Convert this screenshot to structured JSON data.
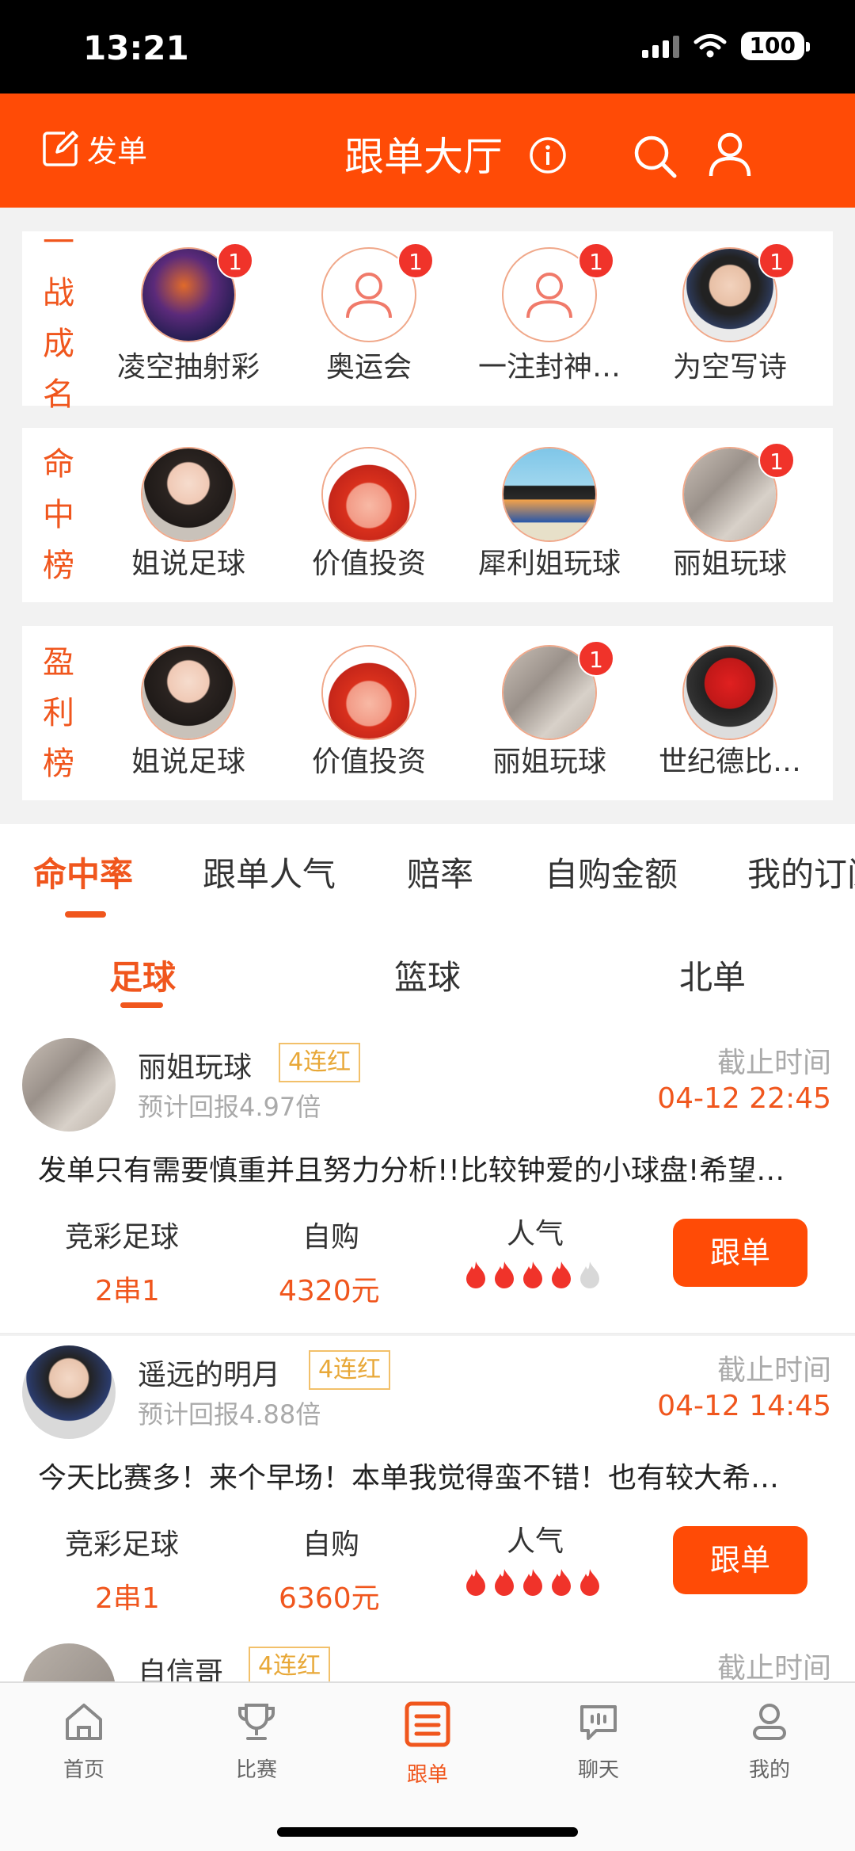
{
  "status_bar": {
    "time": "13:21",
    "battery": "100"
  },
  "header": {
    "post_label": "发单",
    "title": "跟单大厅"
  },
  "rankings": [
    {
      "label": [
        "一",
        "战",
        "成",
        "名"
      ],
      "users": [
        {
          "name": "凌空抽射彩",
          "badge": "1",
          "avatar": "photo"
        },
        {
          "name": "奥运会",
          "badge": "1",
          "avatar": "default"
        },
        {
          "name": "一注封神…",
          "badge": "1",
          "avatar": "default"
        },
        {
          "name": "为空写诗",
          "badge": "1",
          "avatar": "photo"
        }
      ]
    },
    {
      "label": [
        "命",
        "中",
        "榜"
      ],
      "users": [
        {
          "name": "姐说足球",
          "badge": "",
          "avatar": "photo"
        },
        {
          "name": "价值投资",
          "badge": "",
          "avatar": "photo"
        },
        {
          "name": "犀利姐玩球",
          "badge": "",
          "avatar": "photo"
        },
        {
          "name": "丽姐玩球",
          "badge": "1",
          "avatar": "photo"
        }
      ]
    },
    {
      "label": [
        "盈",
        "利",
        "榜"
      ],
      "users": [
        {
          "name": "姐说足球",
          "badge": "",
          "avatar": "photo"
        },
        {
          "name": "价值投资",
          "badge": "",
          "avatar": "photo"
        },
        {
          "name": "丽姐玩球",
          "badge": "1",
          "avatar": "photo"
        },
        {
          "name": "世纪德比…",
          "badge": "",
          "avatar": "photo"
        }
      ]
    }
  ],
  "main_tabs": [
    "命中率",
    "跟单人气",
    "赔率",
    "自购金额",
    "我的订阅"
  ],
  "main_tab_active": "命中率",
  "sub_tabs": [
    "足球",
    "篮球",
    "北单"
  ],
  "sub_tab_active": "足球",
  "posts": [
    {
      "name": "丽姐玩球",
      "streak": "4连红",
      "return": "预计回报4.97倍",
      "deadline_label": "截止时间",
      "deadline": "04-12 22:45",
      "desc": "发单只有需要慎重并且努力分析!!比较钟爱的小球盘!希望…",
      "stat1_label": "竞彩足球",
      "stat1_value": "2串1",
      "stat2_label": "自购",
      "stat2_value": "4320元",
      "stat3_label": "人气",
      "popularity": 4,
      "follow_label": "跟单"
    },
    {
      "name": "遥远的明月",
      "streak": "4连红",
      "return": "预计回报4.88倍",
      "deadline_label": "截止时间",
      "deadline": "04-12 14:45",
      "desc": "今天比赛多！来个早场！本单我觉得蛮不错！也有较大希…",
      "stat1_label": "竞彩足球",
      "stat1_value": "2串1",
      "stat2_label": "自购",
      "stat2_value": "6360元",
      "stat3_label": "人气",
      "popularity": 5,
      "follow_label": "跟单"
    }
  ],
  "peek_post": {
    "name": "自信哥",
    "streak": "4连红",
    "deadline_label": "截止时间"
  },
  "bottom_nav": [
    {
      "label": "首页",
      "icon": "home-icon"
    },
    {
      "label": "比赛",
      "icon": "trophy-icon"
    },
    {
      "label": "跟单",
      "icon": "follow-list-icon"
    },
    {
      "label": "聊天",
      "icon": "chat-icon"
    },
    {
      "label": "我的",
      "icon": "profile-icon"
    }
  ],
  "bottom_nav_active": "跟单",
  "colors": {
    "brand": "#ff4b06",
    "accent": "#f0561d",
    "streak": "#e8a838"
  }
}
